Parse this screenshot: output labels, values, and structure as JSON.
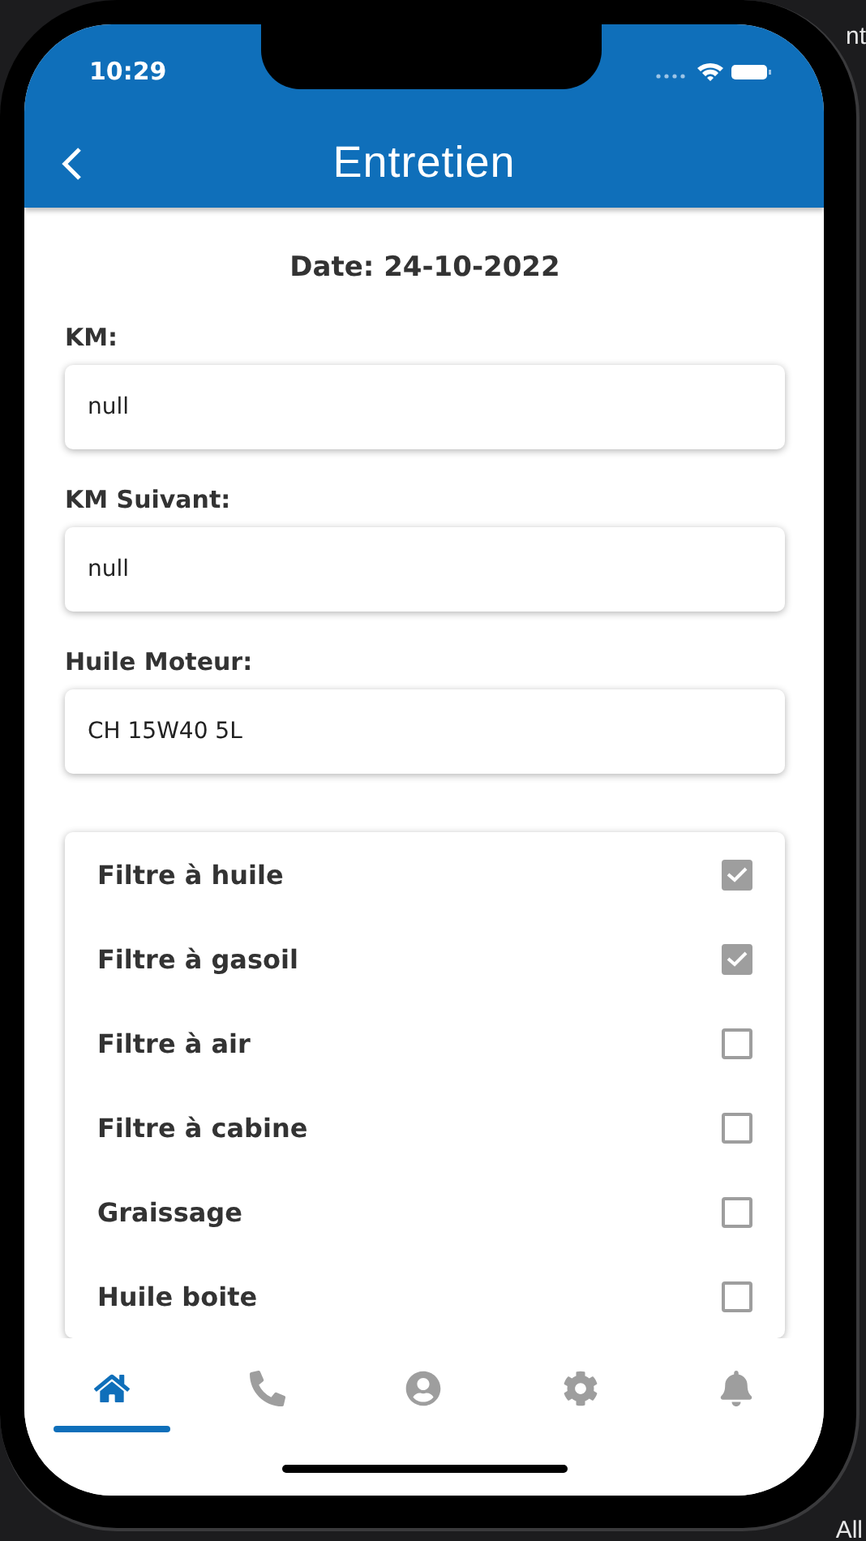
{
  "background_fragments": {
    "top_right": "nt",
    "bottom_right": "All"
  },
  "status_bar": {
    "time": "10:29"
  },
  "header": {
    "title": "Entretien"
  },
  "date": "Date: 24-10-2022",
  "fields": [
    {
      "label": "KM:",
      "value": "null"
    },
    {
      "label": "KM Suivant:",
      "value": "null"
    },
    {
      "label": "Huile Moteur:",
      "value": "CH 15W40 5L"
    }
  ],
  "checklist": [
    {
      "label": "Filtre à huile",
      "checked": true
    },
    {
      "label": "Filtre à gasoil",
      "checked": true
    },
    {
      "label": "Filtre à air",
      "checked": false
    },
    {
      "label": "Filtre à cabine",
      "checked": false
    },
    {
      "label": "Graissage",
      "checked": false
    },
    {
      "label": "Huile boite",
      "checked": false
    }
  ],
  "nav": [
    {
      "kind": "home",
      "selected": true
    },
    {
      "kind": "phone",
      "selected": false
    },
    {
      "kind": "account",
      "selected": false
    },
    {
      "kind": "settings",
      "selected": false
    },
    {
      "kind": "bell",
      "selected": false
    }
  ]
}
